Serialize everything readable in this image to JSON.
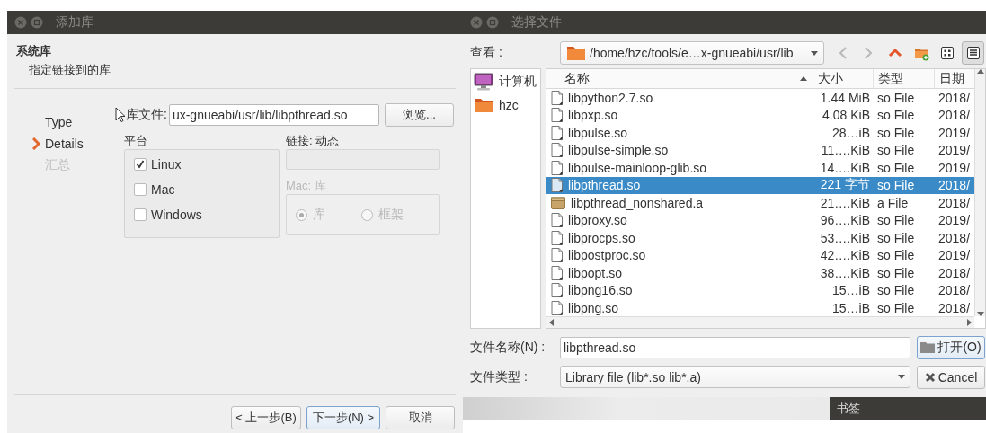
{
  "left_dialog": {
    "title": "添加库",
    "heading": "系统库",
    "subheading": "指定链接到的库",
    "steps": [
      {
        "label": "Type",
        "selected": false,
        "disabled": false
      },
      {
        "label": "Details",
        "selected": true,
        "disabled": false
      },
      {
        "label": "汇总",
        "selected": false,
        "disabled": true
      }
    ],
    "library_file": {
      "label": "库文件:",
      "value": "ux-gnueabi/usr/lib/libpthread.so",
      "button": "浏览..."
    },
    "platform": {
      "label": "平台",
      "options": [
        {
          "label": "Linux",
          "checked": true
        },
        {
          "label": "Mac",
          "checked": false
        },
        {
          "label": "Windows",
          "checked": false
        }
      ]
    },
    "linkage": {
      "label": "链接: 动态",
      "disabled": true
    },
    "mac": {
      "label": "Mac: 库",
      "disabled": true,
      "options": [
        {
          "label": "库",
          "selected": true
        },
        {
          "label": "框架",
          "selected": false
        }
      ]
    },
    "buttons": [
      {
        "label": "< 上一步(B)",
        "focused": false
      },
      {
        "label": "下一步(N) >",
        "focused": true
      },
      {
        "label": "取消",
        "focused": false
      }
    ]
  },
  "right_dialog": {
    "title": "选择文件",
    "look_in": {
      "label": "查看 :",
      "path": "/home/hzc/tools/e…x-gnueabi/usr/lib"
    },
    "toolbar": [
      {
        "kind": "back",
        "disabled": true,
        "selected": false
      },
      {
        "kind": "forward",
        "disabled": true,
        "selected": false
      },
      {
        "kind": "up",
        "disabled": false,
        "selected": false
      },
      {
        "kind": "new-folder",
        "disabled": false,
        "selected": false
      },
      {
        "kind": "icon-view",
        "disabled": false,
        "selected": false
      },
      {
        "kind": "detail-view",
        "disabled": false,
        "selected": true
      }
    ],
    "places": [
      {
        "label": "计算机",
        "kind": "computer"
      },
      {
        "label": "hzc",
        "kind": "folder"
      }
    ],
    "columns": [
      {
        "label": "名称",
        "sorted": true
      },
      {
        "label": "大小",
        "sorted": false
      },
      {
        "label": "类型",
        "sorted": false
      },
      {
        "label": "日期",
        "sorted": false
      }
    ],
    "files": [
      {
        "name": "libpython2.7.so",
        "size": "1.44 MiB",
        "type": "so File",
        "date": "2018/",
        "kind": "file",
        "selected": false
      },
      {
        "name": "libpxp.so",
        "size": "4.08 KiB",
        "type": "so File",
        "date": "2018/",
        "kind": "file",
        "selected": false
      },
      {
        "name": "libpulse.so",
        "size": "28…iB",
        "type": "so File",
        "date": "2019/",
        "kind": "file",
        "selected": false
      },
      {
        "name": "libpulse-simple.so",
        "size": "11….KiB",
        "type": "so File",
        "date": "2019/",
        "kind": "file",
        "selected": false
      },
      {
        "name": "libpulse-mainloop-glib.so",
        "size": "14….KiB",
        "type": "so File",
        "date": "2019/",
        "kind": "file",
        "selected": false
      },
      {
        "name": "libpthread.so",
        "size": "221 字节",
        "type": "so File",
        "date": "2018/",
        "kind": "file",
        "selected": true
      },
      {
        "name": "libpthread_nonshared.a",
        "size": "21….KiB",
        "type": "a File",
        "date": "2018/",
        "kind": "archive",
        "selected": false
      },
      {
        "name": "libproxy.so",
        "size": "96….KiB",
        "type": "so File",
        "date": "2019/",
        "kind": "file",
        "selected": false
      },
      {
        "name": "libprocps.so",
        "size": "53….KiB",
        "type": "so File",
        "date": "2018/",
        "kind": "file",
        "selected": false
      },
      {
        "name": "libpostproc.so",
        "size": "42….KiB",
        "type": "so File",
        "date": "2019/",
        "kind": "file",
        "selected": false
      },
      {
        "name": "libpopt.so",
        "size": "38….KiB",
        "type": "so File",
        "date": "2018/",
        "kind": "file",
        "selected": false
      },
      {
        "name": "libpng16.so",
        "size": "15…iB",
        "type": "so File",
        "date": "2018/",
        "kind": "file",
        "selected": false
      },
      {
        "name": "libpng.so",
        "size": "15…iB",
        "type": "so File",
        "date": "2018/",
        "kind": "file",
        "selected": false
      }
    ],
    "file_name": {
      "label": "文件名称(N) :",
      "value": "libpthread.so"
    },
    "open_button": "打开(O)",
    "file_type": {
      "label": "文件类型 :",
      "value": "Library file (lib*.so lib*.a)"
    },
    "cancel_button": "Cancel"
  },
  "bookmarks_panel": {
    "title": "书签"
  }
}
